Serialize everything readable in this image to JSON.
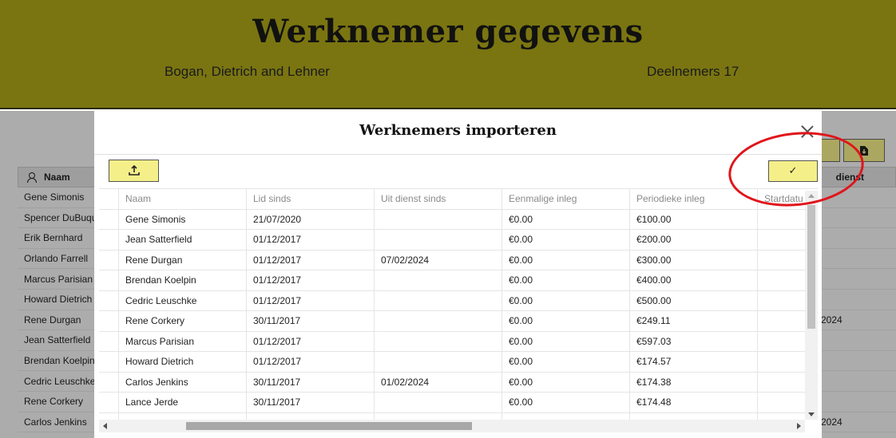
{
  "header": {
    "title": "Werknemer gegevens",
    "company": "Bogan, Dietrich and Lehner",
    "participants": "Deelnemers 17"
  },
  "background_table": {
    "header_name": "Naam",
    "header_right": "dienst",
    "rows": [
      {
        "name": "Gene Simonis",
        "extra": ""
      },
      {
        "name": "Spencer DuBuque",
        "extra": ""
      },
      {
        "name": "Erik Bernhard",
        "extra": ""
      },
      {
        "name": "Orlando Farrell",
        "extra": ""
      },
      {
        "name": "Marcus Parisian",
        "extra": ""
      },
      {
        "name": "Howard Dietrich",
        "extra": ""
      },
      {
        "name": "Rene Durgan",
        "extra": "2024"
      },
      {
        "name": "Jean Satterfield",
        "extra": ""
      },
      {
        "name": "Brendan Koelpin",
        "extra": ""
      },
      {
        "name": "Cedric Leuschke",
        "extra": ""
      },
      {
        "name": "Rene Corkery",
        "extra": ""
      },
      {
        "name": "Carlos Jenkins",
        "extra": "2024"
      }
    ]
  },
  "modal": {
    "title": "Werknemers importeren",
    "upload_icon": "upload-icon",
    "confirm_icon": "check-icon",
    "confirm_label": "✓",
    "columns": [
      "Naam",
      "Lid sinds",
      "Uit dienst sinds",
      "Eenmalige inleg",
      "Periodieke inleg",
      "Startdatu"
    ],
    "rows": [
      [
        "Gene Simonis",
        "21/07/2020",
        "",
        "€0.00",
        "€100.00",
        ""
      ],
      [
        "Jean Satterfield",
        "01/12/2017",
        "",
        "€0.00",
        "€200.00",
        ""
      ],
      [
        "Rene Durgan",
        "01/12/2017",
        "07/02/2024",
        "€0.00",
        "€300.00",
        ""
      ],
      [
        "Brendan Koelpin",
        "01/12/2017",
        "",
        "€0.00",
        "€400.00",
        ""
      ],
      [
        "Cedric Leuschke",
        "01/12/2017",
        "",
        "€0.00",
        "€500.00",
        ""
      ],
      [
        "Rene Corkery",
        "30/11/2017",
        "",
        "€0.00",
        "€249.11",
        ""
      ],
      [
        "Marcus Parisian",
        "01/12/2017",
        "",
        "€0.00",
        "€597.03",
        ""
      ],
      [
        "Howard Dietrich",
        "01/12/2017",
        "",
        "€0.00",
        "€174.57",
        ""
      ],
      [
        "Carlos Jenkins",
        "30/11/2017",
        "01/02/2024",
        "€0.00",
        "€174.38",
        ""
      ],
      [
        "Lance Jerde",
        "30/11/2017",
        "",
        "€0.00",
        "€174.48",
        ""
      ],
      [
        "",
        "",
        "",
        "",
        "",
        ""
      ]
    ]
  },
  "colors": {
    "header_bg": "#7a7511",
    "button_bg": "#f5ef8a",
    "annotation": "#e0151b"
  }
}
